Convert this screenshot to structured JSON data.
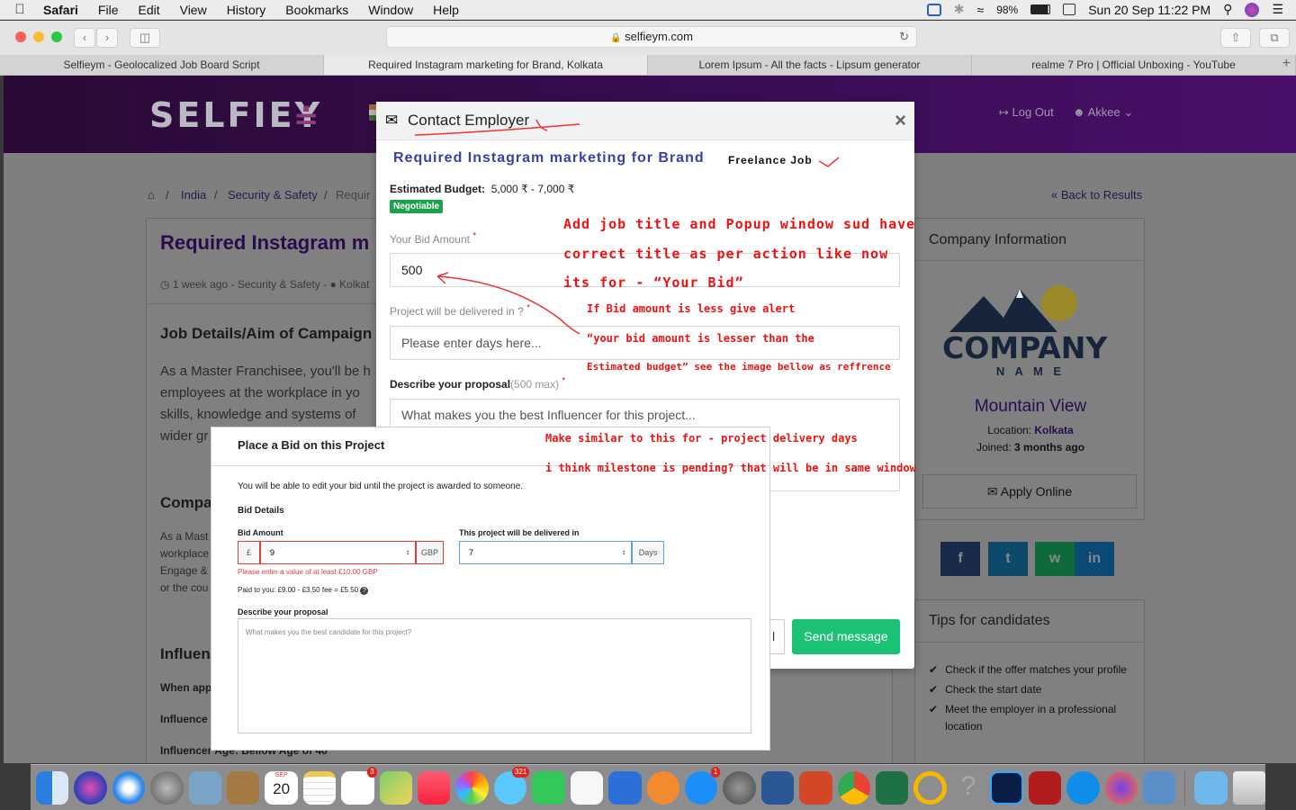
{
  "menubar": {
    "app": "Safari",
    "items": [
      "File",
      "Edit",
      "View",
      "History",
      "Bookmarks",
      "Window",
      "Help"
    ],
    "battery": "98%",
    "clock": "Sun 20 Sep  11:22 PM"
  },
  "browser": {
    "url": "selfieym.com",
    "tabs": [
      "Selfieym - Geolocalized Job Board Script",
      "Required Instagram marketing for Brand, Kolkata",
      "Lorem Ipsum - All the facts - Lipsum generator",
      "realme 7 Pro | Official Unboxing - YouTube"
    ],
    "tab_new": "+"
  },
  "site": {
    "logo": "SELFIEY",
    "logout": "Log Out",
    "user": "Akkee",
    "breadcrumbs": [
      "India",
      "Security & Safety",
      "Requir"
    ],
    "back": "Back to Results",
    "job_title": "Required Instagram m",
    "job_meta": "1 week ago - Security & Safety -",
    "job_meta_loc": "Kolkat",
    "section1": "Job Details/Aim of Campaign",
    "para1": [
      "As a Master Franchisee, you'll be h",
      "employees at the workplace in yo",
      "skills, knowledge and systems of",
      "wider gr"
    ],
    "section2": "Compa",
    "para2": [
      "As a Mast",
      "workplace",
      "Engage &",
      "or the cou"
    ],
    "section3": "Influen",
    "when": "When app",
    "influencer": "Influence",
    "age": "Influencer Age: Bellow Age of 40",
    "company_info": "Company Information",
    "company_logo_main": "COMPANY",
    "company_logo_sub": "N A M E",
    "company_name": "Mountain View",
    "location_label": "Location:",
    "location_value": "Kolkata",
    "joined_label": "Joined:",
    "joined_value": "3 months ago",
    "apply": "Apply Online",
    "tips_title": "Tips for candidates",
    "tips": [
      "Check if the offer matches your profile",
      "Check the start date",
      "Meet the employer in a professional location"
    ],
    "social": [
      "f",
      "t",
      "w",
      "in"
    ]
  },
  "modal": {
    "title": "Contact Employer",
    "close": "×",
    "job_title": "Required Instagram marketing for Brand",
    "job_type": "Freelance Job",
    "budget_label": "Estimated Budget:",
    "budget_value": "5,000 ₹  -  7,000 ₹",
    "negotiable": "Negotiable",
    "bid_label": "Your Bid Amount",
    "bid_value": "500",
    "delivery_label": "Project will be delivered in ?",
    "delivery_placeholder": "Please enter days here...",
    "proposal_label": "Describe your proposal",
    "proposal_max": "(500 max)",
    "proposal_placeholder": "What makes you the best Influencer for this project...",
    "cancel_partial": "l",
    "send": "Send message",
    "required_mark": "*"
  },
  "annotations": {
    "a1": "Add job title and Popup window sud have",
    "a2": "correct title as per action like now",
    "a3": "its for - “Your Bid”",
    "a4": "If Bid amount is less give alert",
    "a5": "“your bid amount is lesser than the",
    "a6": "Estimated budget” see the image bellow as reffrence",
    "a7": "Make similar to this for - project delivery days",
    "a8": "i think milestone is pending? that will be in same window"
  },
  "bid": {
    "title": "Place a Bid on this Project",
    "note": "You will be able to edit your bid until the project is awarded to someone.",
    "details": "Bid Details",
    "amount_label": "Bid Amount",
    "currency": "£",
    "amount_value": "9",
    "amount_unit": "GBP",
    "error": "Please enter a value of at least £10.00 GBP",
    "paid": "Paid to you: £9.00 - £3.50 fee = £5.50",
    "delivery_label": "This project will be delivered in",
    "delivery_value": "7",
    "delivery_unit": "Days",
    "proposal_label": "Describe your proposal",
    "proposal_placeholder": "What makes you the best candidate for this project?"
  },
  "dock": {
    "calendar_month": "SEP",
    "calendar_day": "20",
    "badges": {
      "reminders": "3",
      "messages": "321",
      "appstore": "1"
    }
  }
}
